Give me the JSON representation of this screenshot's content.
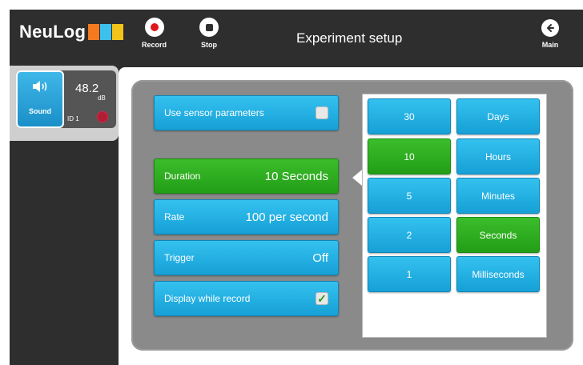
{
  "app": {
    "logo_text": "NeuLog",
    "logo_colors": [
      "#f57a1f",
      "#3cc0ee",
      "#f2c318"
    ]
  },
  "toolbar": {
    "record_label": "Record",
    "stop_label": "Stop",
    "main_label": "Main"
  },
  "page": {
    "title": "Experiment setup"
  },
  "sensor": {
    "name": "Sound",
    "value": "48.2",
    "unit": "dB",
    "id": "ID 1",
    "icon": "speaker-icon",
    "status_color": "#b01d34"
  },
  "settings": {
    "use_sensor_parameters": {
      "label": "Use sensor parameters",
      "checked": false
    },
    "duration": {
      "label": "Duration",
      "value": "10 Seconds",
      "selected": true
    },
    "rate": {
      "label": "Rate",
      "value": "100 per second"
    },
    "trigger": {
      "label": "Trigger",
      "value": "Off"
    },
    "display_while_record": {
      "label": "Display while record",
      "checked": true,
      "check_glyph": "✓"
    }
  },
  "picker": {
    "numbers": [
      {
        "label": "30",
        "selected": false
      },
      {
        "label": "10",
        "selected": true
      },
      {
        "label": "5",
        "selected": false
      },
      {
        "label": "2",
        "selected": false
      },
      {
        "label": "1",
        "selected": false
      }
    ],
    "units": [
      {
        "label": "Days",
        "selected": false
      },
      {
        "label": "Hours",
        "selected": false
      },
      {
        "label": "Minutes",
        "selected": false
      },
      {
        "label": "Seconds",
        "selected": true
      },
      {
        "label": "Milliseconds",
        "selected": false
      }
    ]
  },
  "colors": {
    "accent_blue": "#1fa9df",
    "selected_green": "#2aa51d",
    "topbar": "#2e2e2e"
  }
}
